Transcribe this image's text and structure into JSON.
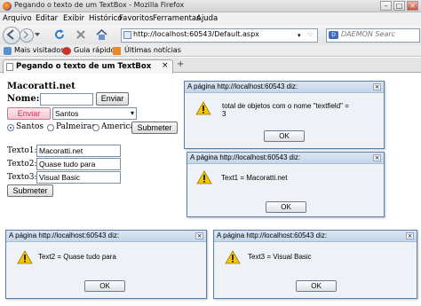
{
  "window": {
    "title": "Pegando o texto de um TextBox - Mozilla Firefox",
    "controls": {
      "minimize": "–",
      "maximize": "□",
      "close": "×"
    }
  },
  "menu": {
    "items": [
      "Arquivo",
      "Editar",
      "Exibir",
      "Histórico",
      "Favoritos",
      "Ferramentas",
      "Ajuda"
    ]
  },
  "navigation": {
    "url": "http://localhost:60543/Default.aspx",
    "search_placeholder": "DAEMON Searc"
  },
  "bookmarks": {
    "items": [
      "Mais visitados",
      "Guia rápido",
      "Últimas notícias"
    ]
  },
  "tab": {
    "title": "Pegando o texto de um TextBox",
    "close": "×",
    "new_tab": "+"
  },
  "page": {
    "heading": "Macoratti.net",
    "nome_label": "Nome:",
    "nome_value": "",
    "enviar_label": "Enviar",
    "enviar_pink_label": "Enviar",
    "select_value": "Santos",
    "radio_options": [
      "Santos",
      "Palmeiras",
      "America"
    ],
    "radio_selected": "Santos",
    "submeter_label": "Submeter",
    "texto1_label": "Texto1:",
    "texto1_value": "Macoratti.net",
    "texto2_label": "Texto2:",
    "texto2_value": "Quase tudo para",
    "texto3_label": "Texto3:",
    "texto3_value": "Visual Basic",
    "submeter2_label": "Submeter"
  },
  "dialogs": [
    {
      "title": "A página http://localhost:60543 diz:",
      "message": "total de objetos com o nome \"textfield\" =\n3",
      "ok": "OK"
    },
    {
      "title": "A página http://localhost:60543 diz:",
      "message": "Text1 = Macoratti.net",
      "ok": "OK"
    },
    {
      "title": "A página http://localhost:60543 diz:",
      "message": "Text2 = Quase tudo para",
      "ok": "OK"
    },
    {
      "title": "A página http://localhost:60543 diz:",
      "message": "Text3 = Visual Basic",
      "ok": "OK"
    }
  ],
  "colors": {
    "dialog_border": "#5a7fa9",
    "dialog_bg": "#eef2f7",
    "warning_yellow": "#f6c700",
    "pink_button_text": "#d0305a"
  }
}
